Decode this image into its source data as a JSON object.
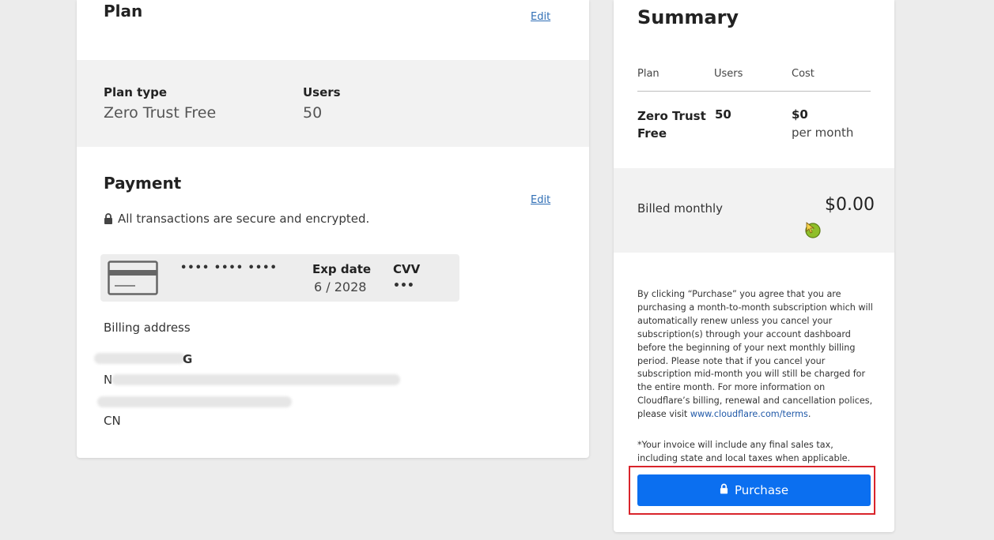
{
  "plan_section": {
    "title": "Plan",
    "edit_label": "Edit",
    "plan_type_label": "Plan type",
    "plan_type_value": "Zero Trust Free",
    "users_label": "Users",
    "users_value": "50"
  },
  "payment_section": {
    "title": "Payment",
    "edit_label": "Edit",
    "secure_text": "All transactions are secure and encrypted.",
    "card_number_masked": "•••• •••• ••••",
    "exp_label": "Exp date",
    "exp_value": "6 / 2028",
    "cvv_label": "CVV",
    "cvv_value": "•••",
    "billing_address_label": "Billing address",
    "address_fragments": [
      "G",
      "N"
    ],
    "country": "CN"
  },
  "summary": {
    "title": "Summary",
    "columns": [
      "Plan",
      "Users",
      "Cost"
    ],
    "row": {
      "plan": "Zero Trust Free",
      "users": "50",
      "cost": "$0",
      "cost_period": "per month"
    },
    "billed_label": "Billed monthly",
    "billed_amount": "$0.00",
    "terms_text": "By clicking “Purchase” you agree that you are purchasing a month-to-month subscription which will automatically renew unless you cancel your subscription(s) through your account dashboard before the beginning of your next monthly billing period. Please note that if you cancel your subscription mid-month you will still be charged for the entire month. For more information on Cloudflare’s billing, renewal and cancellation polices, please visit",
    "terms_link": "www.cloudflare.com/terms",
    "terms_end": ".",
    "tax_note": "*Your invoice will include any final sales tax, including state and local taxes when applicable.",
    "purchase_label": "Purchase"
  },
  "icons": {
    "secure": "lock-icon",
    "card": "credit-card-icon",
    "purchase": "lock-icon"
  },
  "colors": {
    "accent": "#0b6ff0",
    "link": "#2f6eb5",
    "highlight": "#d9242b",
    "band": "#f2f2f2"
  }
}
